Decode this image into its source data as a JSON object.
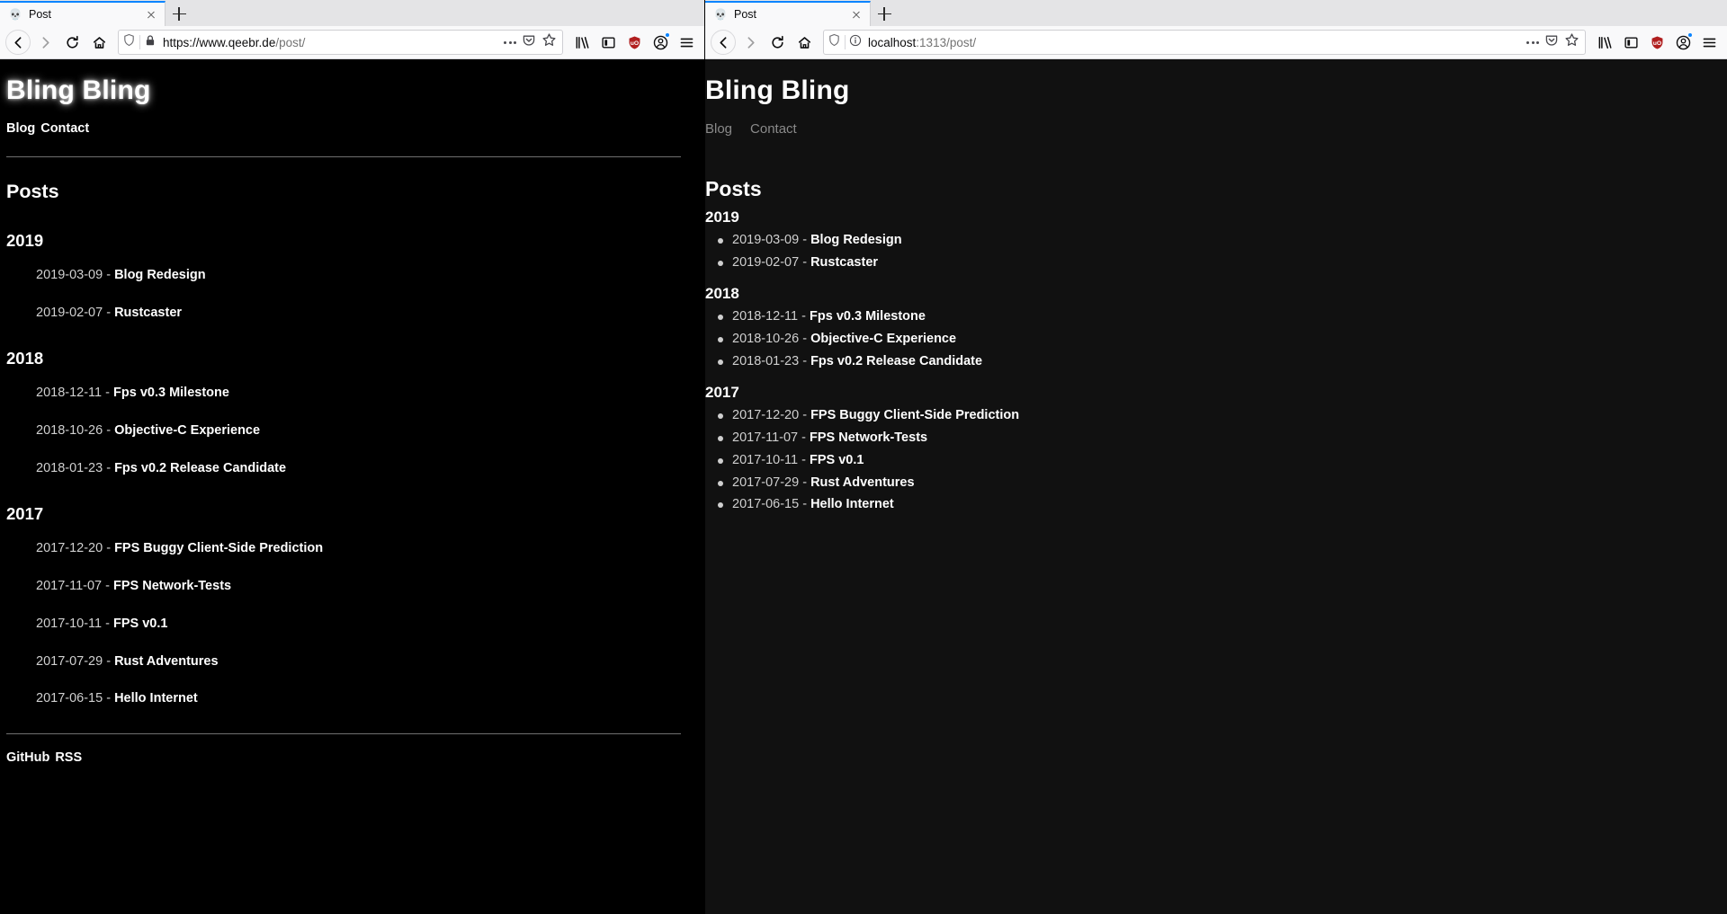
{
  "windows": [
    {
      "id": "left",
      "tab": {
        "title": "Post",
        "favicon": "skull-icon"
      },
      "url": {
        "host": "https://www.qeebr.de",
        "path": "/post/",
        "security": "lock-icon",
        "shield": "tracking-protection-icon"
      },
      "toolbar": {
        "back": "back-icon",
        "forward": "forward-icon",
        "reload": "reload-icon",
        "home": "home-icon",
        "page_actions": "ellipsis-icon",
        "pocket": "pocket-icon",
        "bookmark": "star-icon",
        "library": "library-icon",
        "sidebar": "sidebar-icon",
        "ublock": "ublock-shield-icon",
        "account": "account-icon",
        "menu": "hamburger-menu-icon"
      },
      "page": {
        "style": "glow",
        "site_title": "Bling Bling",
        "nav": [
          "Blog",
          "Contact"
        ],
        "posts_heading": "Posts",
        "years": [
          {
            "year": "2019",
            "entries": [
              {
                "date": "2019-03-09",
                "sep": "-",
                "title": "Blog Redesign"
              },
              {
                "date": "2019-02-07",
                "sep": "-",
                "title": "Rustcaster"
              }
            ]
          },
          {
            "year": "2018",
            "entries": [
              {
                "date": "2018-12-11",
                "sep": "-",
                "title": "Fps v0.3 Milestone"
              },
              {
                "date": "2018-10-26",
                "sep": "-",
                "title": "Objective-C Experience"
              },
              {
                "date": "2018-01-23",
                "sep": "-",
                "title": "Fps v0.2 Release Candidate"
              }
            ]
          },
          {
            "year": "2017",
            "entries": [
              {
                "date": "2017-12-20",
                "sep": "-",
                "title": "FPS Buggy Client-Side Prediction"
              },
              {
                "date": "2017-11-07",
                "sep": "-",
                "title": "FPS Network-Tests"
              },
              {
                "date": "2017-10-11",
                "sep": "-",
                "title": "FPS v0.1"
              },
              {
                "date": "2017-07-29",
                "sep": "-",
                "title": "Rust Adventures"
              },
              {
                "date": "2017-06-15",
                "sep": "-",
                "title": "Hello Internet"
              }
            ]
          }
        ],
        "footer": [
          "GitHub",
          "RSS"
        ]
      }
    },
    {
      "id": "right",
      "tab": {
        "title": "Post",
        "favicon": "skull-icon"
      },
      "url": {
        "host": "localhost",
        "path": ":1313/post/",
        "security": "info-icon",
        "shield": "tracking-protection-icon"
      },
      "toolbar": {
        "back": "back-icon",
        "forward": "forward-icon",
        "reload": "reload-icon",
        "home": "home-icon",
        "page_actions": "ellipsis-icon",
        "pocket": "pocket-icon",
        "bookmark": "star-icon",
        "library": "library-icon",
        "sidebar": "sidebar-icon",
        "ublock": "ublock-shield-icon",
        "account": "account-icon",
        "menu": "hamburger-menu-icon"
      },
      "page": {
        "style": "plain",
        "site_title": "Bling Bling",
        "nav": [
          "Blog",
          "Contact"
        ],
        "posts_heading": "Posts",
        "years": [
          {
            "year": "2019",
            "entries": [
              {
                "date": "2019-03-09",
                "sep": "-",
                "title": "Blog Redesign"
              },
              {
                "date": "2019-02-07",
                "sep": "-",
                "title": "Rustcaster"
              }
            ]
          },
          {
            "year": "2018",
            "entries": [
              {
                "date": "2018-12-11",
                "sep": "-",
                "title": "Fps v0.3 Milestone"
              },
              {
                "date": "2018-10-26",
                "sep": "-",
                "title": "Objective-C Experience"
              },
              {
                "date": "2018-01-23",
                "sep": "-",
                "title": "Fps v0.2 Release Candidate"
              }
            ]
          },
          {
            "year": "2017",
            "entries": [
              {
                "date": "2017-12-20",
                "sep": "-",
                "title": "FPS Buggy Client-Side Prediction"
              },
              {
                "date": "2017-11-07",
                "sep": "-",
                "title": "FPS Network-Tests"
              },
              {
                "date": "2017-10-11",
                "sep": "-",
                "title": "FPS v0.1"
              },
              {
                "date": "2017-07-29",
                "sep": "-",
                "title": "Rust Adventures"
              },
              {
                "date": "2017-06-15",
                "sep": "-",
                "title": "Hello Internet"
              }
            ]
          }
        ],
        "footer": []
      }
    }
  ],
  "colors": {
    "tab_accent": "#0a84ff",
    "chrome_bg": "#f9f9fa",
    "tabstrip_bg": "#e4e4e6",
    "ublock_red": "#b11f1f",
    "page_bg_left": "#000000",
    "page_bg_right": "#111111",
    "text_white": "#ffffff",
    "date_gray": "#d0d0d0",
    "nav_gray_right": "#8a8a8a"
  }
}
